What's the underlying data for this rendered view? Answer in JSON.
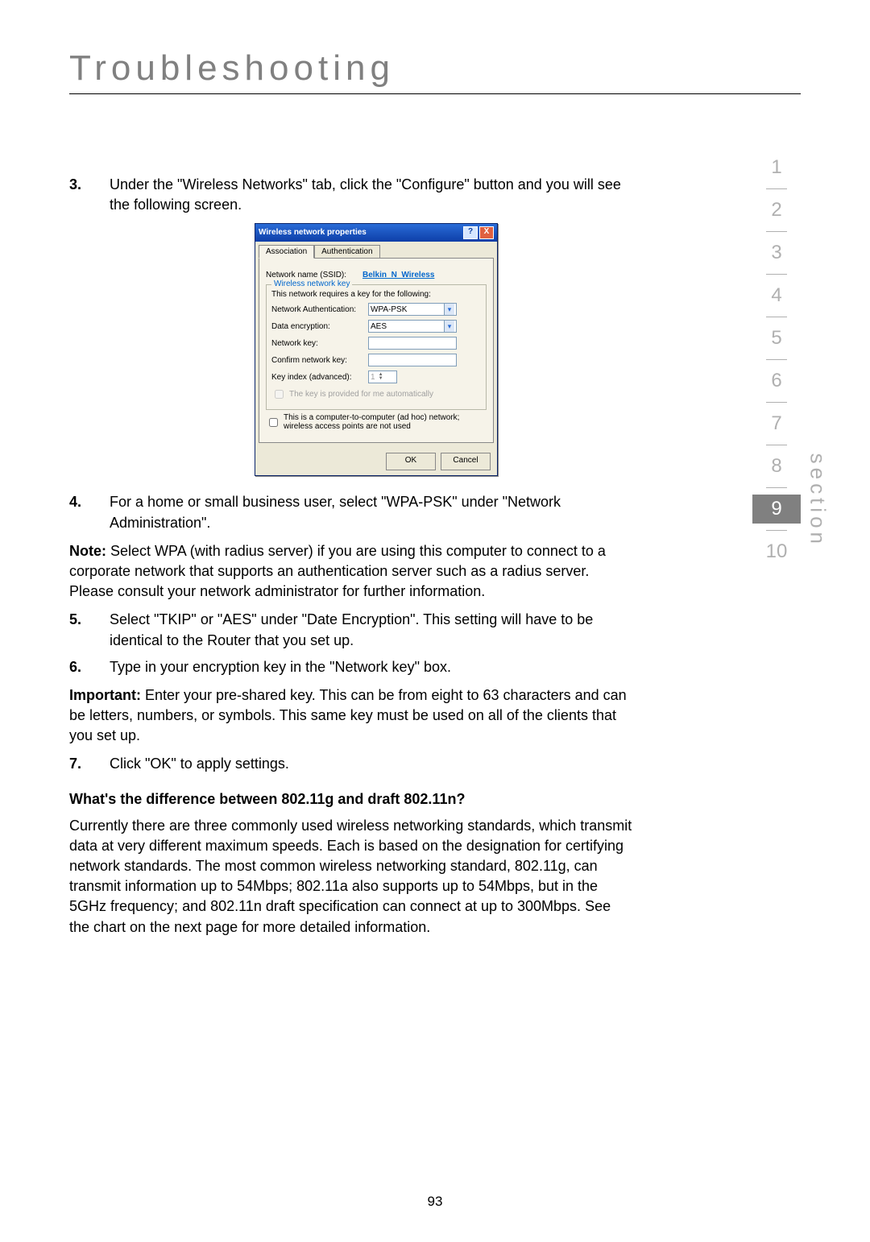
{
  "page_title": "Troubleshooting",
  "page_number": "93",
  "section_label": "section",
  "nav": [
    "1",
    "2",
    "3",
    "4",
    "5",
    "6",
    "7",
    "8",
    "9",
    "10"
  ],
  "nav_current_index": 8,
  "steps": {
    "s3": {
      "num": "3.",
      "text": "Under the \"Wireless Networks\" tab, click the \"Configure\" button and you will see the following screen."
    },
    "s4": {
      "num": "4.",
      "text": "For a home or small business user, select \"WPA-PSK\" under \"Network Administration\"."
    },
    "s5": {
      "num": "5.",
      "text": "Select \"TKIP\" or \"AES\" under \"Date Encryption\". This setting will have to be identical to the Router that you set up."
    },
    "s6": {
      "num": "6.",
      "text": "Type in your encryption key in the \"Network key\" box."
    },
    "s7": {
      "num": "7.",
      "text": "Click \"OK\" to apply settings."
    }
  },
  "note_label": "Note:",
  "note_text": " Select WPA (with radius server) if you are using this computer to connect to a corporate network that supports an authentication server such as a radius server. Please consult your network administrator for further information.",
  "important_label": "Important:",
  "important_text": " Enter your pre-shared key. This can be from eight to 63 characters and can be letters, numbers, or symbols. This same key must be used on all of the clients that you set up.",
  "subhead": "What's the difference between 802.11g and draft 802.11n?",
  "body_para": "Currently there are three commonly used wireless networking standards, which transmit data at very different maximum speeds. Each is based on the designation for certifying network standards. The most common wireless networking standard, 802.11g, can transmit information up to 54Mbps; 802.11a also supports up to 54Mbps, but in the 5GHz frequency; and 802.11n draft specification can connect at up to 300Mbps. See the chart on the next page for more detailed information.",
  "dialog": {
    "title": "Wireless network properties",
    "help": "?",
    "close": "X",
    "tabs": {
      "assoc": "Association",
      "authn": "Authentication"
    },
    "ssid_label": "Network name (SSID):",
    "ssid_value": "Belkin_N_Wireless",
    "group_label": "Wireless network key",
    "group_desc": "This network requires a key for the following:",
    "auth_label": "Network Authentication:",
    "auth_value": "WPA-PSK",
    "enc_label": "Data encryption:",
    "enc_value": "AES",
    "key_label": "Network key:",
    "key2_label": "Confirm network key:",
    "keyindex_label": "Key index (advanced):",
    "keyindex_value": "1",
    "autokey_label": "The key is provided for me automatically",
    "adhoc_label": "This is a computer-to-computer (ad hoc) network; wireless access points are not used",
    "ok": "OK",
    "cancel": "Cancel"
  }
}
